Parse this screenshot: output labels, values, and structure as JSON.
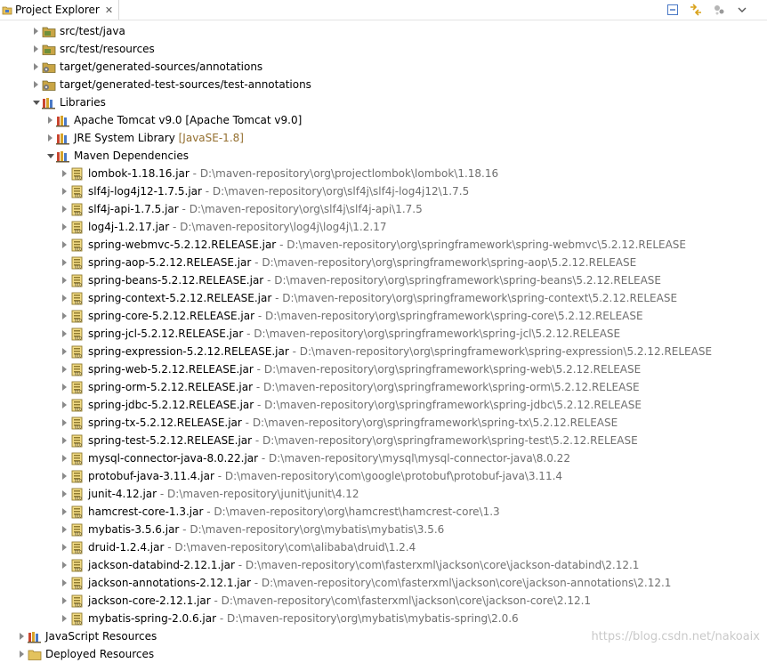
{
  "view": {
    "title": "Project Explorer",
    "close_glyph": "✕",
    "toolbar": [
      {
        "icon": "collapse-all-icon"
      },
      {
        "icon": "link-with-editor-icon"
      },
      {
        "icon": "view-menu-options-icon"
      },
      {
        "icon": "view-menu-chevron-icon"
      }
    ]
  },
  "tree": {
    "folders": [
      {
        "label": "src/test/java"
      },
      {
        "label": "src/test/resources"
      },
      {
        "label": "target/generated-sources/annotations"
      },
      {
        "label": "target/generated-test-sources/test-annotations"
      }
    ],
    "libraries_label": "Libraries",
    "tomcat": {
      "label": "Apache Tomcat v9.0 [Apache Tomcat v9.0]"
    },
    "jre": {
      "label": "JRE System Library",
      "suffix": "[JavaSE-1.8]"
    },
    "maven_label": "Maven Dependencies",
    "jars": [
      {
        "name": "lombok-1.18.16.jar",
        "path": "D:\\maven-repository\\org\\projectlombok\\lombok\\1.18.16"
      },
      {
        "name": "slf4j-log4j12-1.7.5.jar",
        "path": "D:\\maven-repository\\org\\slf4j\\slf4j-log4j12\\1.7.5"
      },
      {
        "name": "slf4j-api-1.7.5.jar",
        "path": "D:\\maven-repository\\org\\slf4j\\slf4j-api\\1.7.5"
      },
      {
        "name": "log4j-1.2.17.jar",
        "path": "D:\\maven-repository\\log4j\\log4j\\1.2.17"
      },
      {
        "name": "spring-webmvc-5.2.12.RELEASE.jar",
        "path": "D:\\maven-repository\\org\\springframework\\spring-webmvc\\5.2.12.RELEASE"
      },
      {
        "name": "spring-aop-5.2.12.RELEASE.jar",
        "path": "D:\\maven-repository\\org\\springframework\\spring-aop\\5.2.12.RELEASE"
      },
      {
        "name": "spring-beans-5.2.12.RELEASE.jar",
        "path": "D:\\maven-repository\\org\\springframework\\spring-beans\\5.2.12.RELEASE"
      },
      {
        "name": "spring-context-5.2.12.RELEASE.jar",
        "path": "D:\\maven-repository\\org\\springframework\\spring-context\\5.2.12.RELEASE"
      },
      {
        "name": "spring-core-5.2.12.RELEASE.jar",
        "path": "D:\\maven-repository\\org\\springframework\\spring-core\\5.2.12.RELEASE"
      },
      {
        "name": "spring-jcl-5.2.12.RELEASE.jar",
        "path": "D:\\maven-repository\\org\\springframework\\spring-jcl\\5.2.12.RELEASE"
      },
      {
        "name": "spring-expression-5.2.12.RELEASE.jar",
        "path": "D:\\maven-repository\\org\\springframework\\spring-expression\\5.2.12.RELEASE"
      },
      {
        "name": "spring-web-5.2.12.RELEASE.jar",
        "path": "D:\\maven-repository\\org\\springframework\\spring-web\\5.2.12.RELEASE"
      },
      {
        "name": "spring-orm-5.2.12.RELEASE.jar",
        "path": "D:\\maven-repository\\org\\springframework\\spring-orm\\5.2.12.RELEASE"
      },
      {
        "name": "spring-jdbc-5.2.12.RELEASE.jar",
        "path": "D:\\maven-repository\\org\\springframework\\spring-jdbc\\5.2.12.RELEASE"
      },
      {
        "name": "spring-tx-5.2.12.RELEASE.jar",
        "path": "D:\\maven-repository\\org\\springframework\\spring-tx\\5.2.12.RELEASE"
      },
      {
        "name": "spring-test-5.2.12.RELEASE.jar",
        "path": "D:\\maven-repository\\org\\springframework\\spring-test\\5.2.12.RELEASE"
      },
      {
        "name": "mysql-connector-java-8.0.22.jar",
        "path": "D:\\maven-repository\\mysql\\mysql-connector-java\\8.0.22"
      },
      {
        "name": "protobuf-java-3.11.4.jar",
        "path": "D:\\maven-repository\\com\\google\\protobuf\\protobuf-java\\3.11.4"
      },
      {
        "name": "junit-4.12.jar",
        "path": "D:\\maven-repository\\junit\\junit\\4.12"
      },
      {
        "name": "hamcrest-core-1.3.jar",
        "path": "D:\\maven-repository\\org\\hamcrest\\hamcrest-core\\1.3"
      },
      {
        "name": "mybatis-3.5.6.jar",
        "path": "D:\\maven-repository\\org\\mybatis\\mybatis\\3.5.6"
      },
      {
        "name": "druid-1.2.4.jar",
        "path": "D:\\maven-repository\\com\\alibaba\\druid\\1.2.4"
      },
      {
        "name": "jackson-databind-2.12.1.jar",
        "path": "D:\\maven-repository\\com\\fasterxml\\jackson\\core\\jackson-databind\\2.12.1"
      },
      {
        "name": "jackson-annotations-2.12.1.jar",
        "path": "D:\\maven-repository\\com\\fasterxml\\jackson\\core\\jackson-annotations\\2.12.1"
      },
      {
        "name": "jackson-core-2.12.1.jar",
        "path": "D:\\maven-repository\\com\\fasterxml\\jackson\\core\\jackson-core\\2.12.1"
      },
      {
        "name": "mybatis-spring-2.0.6.jar",
        "path": "D:\\maven-repository\\org\\mybatis\\mybatis-spring\\2.0.6"
      }
    ],
    "javascript_resources": "JavaScript Resources",
    "deployed_resources": "Deployed Resources"
  },
  "path_separator": " - ",
  "watermark": "https://blog.csdn.net/nakoaix",
  "colors": {
    "path_text": "#6f6f6f",
    "jre_suffix": "#946f2f",
    "jar_icon": "#e9c85a"
  }
}
